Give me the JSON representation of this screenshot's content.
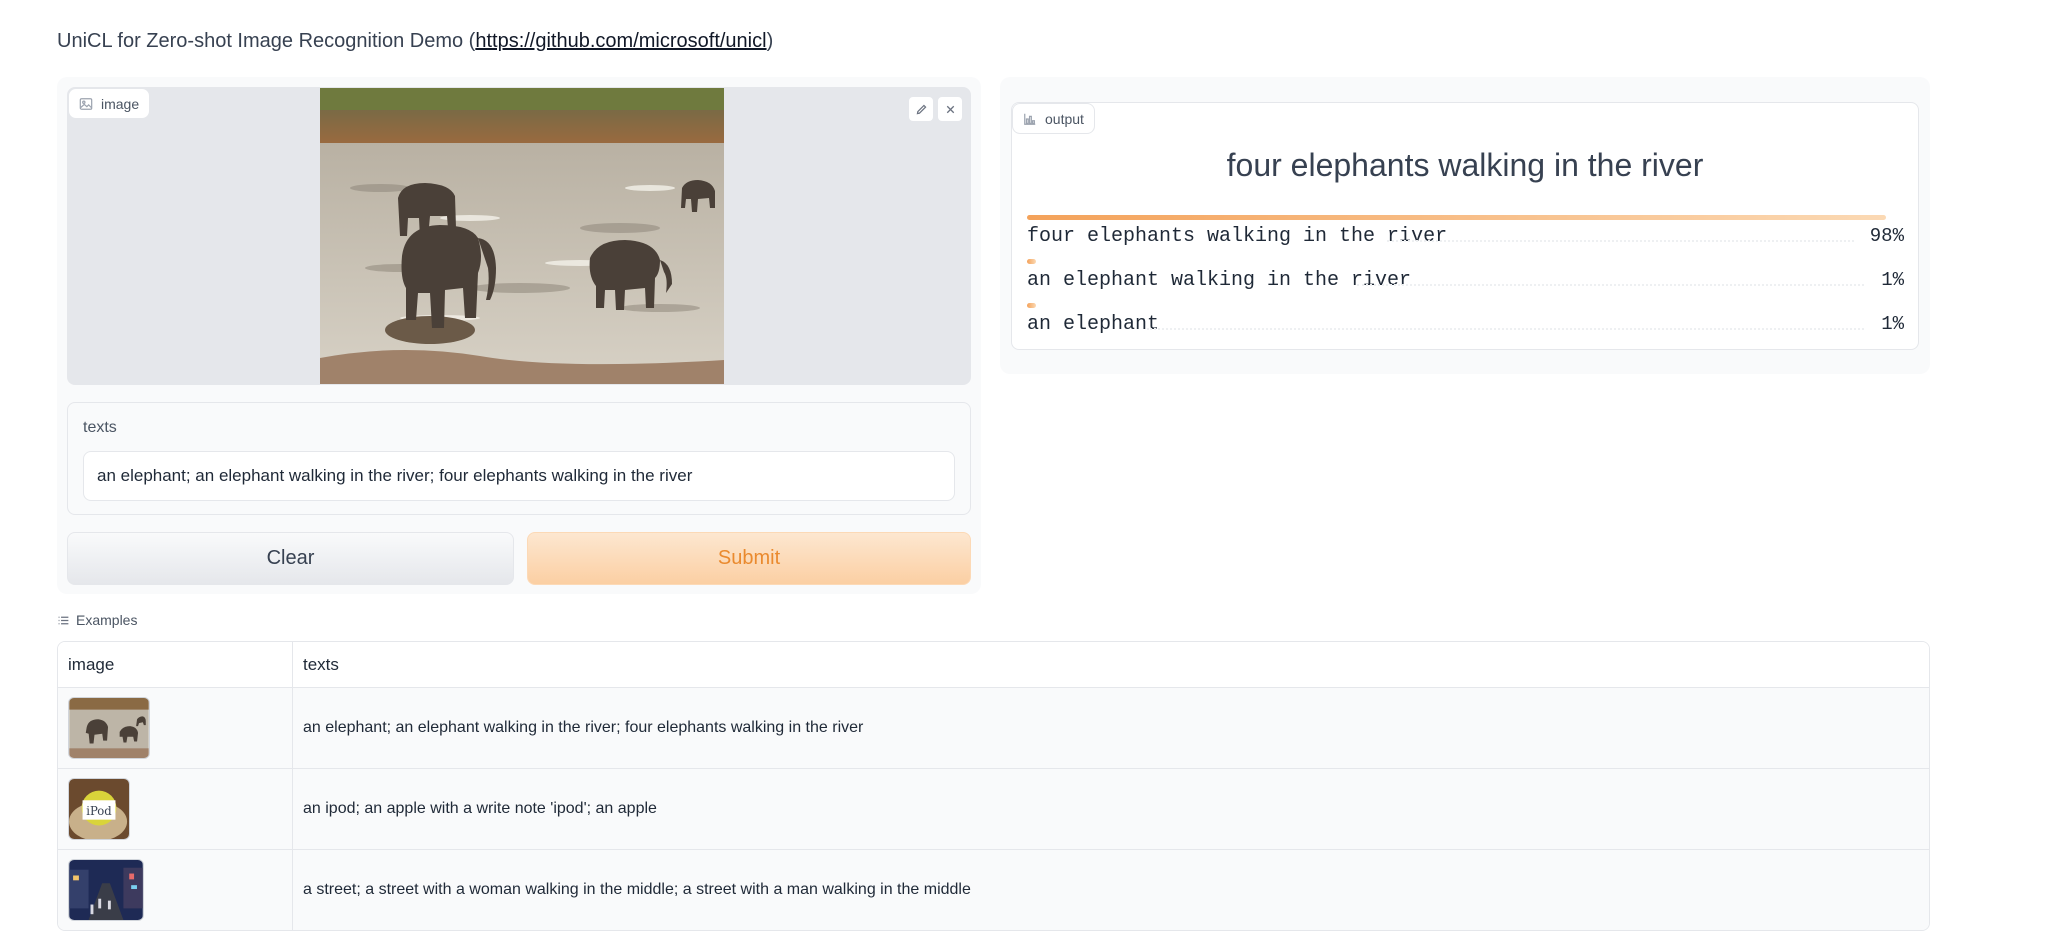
{
  "header": {
    "title_prefix": "UniCL for Zero-shot Image Recognition Demo (",
    "link": "https://github.com/microsoft/unicl",
    "title_suffix": ")"
  },
  "image_input": {
    "label": "image",
    "icon": "image-icon",
    "edit_icon": "pencil-icon",
    "close_icon": "close-icon"
  },
  "texts_input": {
    "label": "texts",
    "value": "an elephant; an elephant walking in the river; four elephants walking in the river"
  },
  "buttons": {
    "clear": "Clear",
    "submit": "Submit"
  },
  "output": {
    "label": "output",
    "icon": "chart-icon",
    "top_label": "four elephants walking in the river",
    "results": [
      {
        "label": "four elephants walking in the river",
        "pct": "98%",
        "fraction": 0.98
      },
      {
        "label": "an elephant walking in the river",
        "pct": "1%",
        "fraction": 0.01
      },
      {
        "label": "an elephant",
        "pct": "1%",
        "fraction": 0.01
      }
    ]
  },
  "examples": {
    "label": "Examples",
    "icon": "list-icon",
    "headers": [
      "image",
      "texts"
    ],
    "rows": [
      {
        "thumb": "elephants-thumbnail",
        "texts": "an elephant; an elephant walking in the river; four elephants walking in the river"
      },
      {
        "thumb": "ipod-apple-thumbnail",
        "texts": "an ipod; an apple with a write note 'ipod'; an apple"
      },
      {
        "thumb": "street-thumbnail",
        "texts": "a street; a street with a woman walking in the middle; a street with a man walking in the middle"
      }
    ]
  },
  "colors": {
    "accent": "#f4a25a",
    "submit_text": "#ea8a2e",
    "panel_bg": "#f9fafb",
    "border": "#e5e7eb"
  }
}
